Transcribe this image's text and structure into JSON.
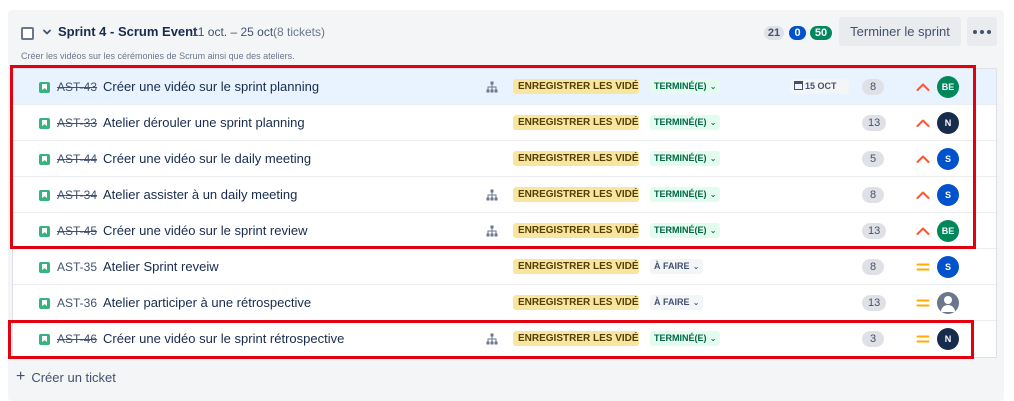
{
  "sprint": {
    "title": "Sprint 4 - Scrum Event",
    "dates": "11 oct. – 25 oct.",
    "ticket_count": "(8 tickets)",
    "goal": "Créer les vidéos sur les cérémonies de Scrum ainsi que des ateliers.",
    "counts": {
      "todo": "21",
      "in_progress": "0",
      "done": "50"
    },
    "end_button": "Terminer le sprint",
    "more_icon": "more-horizontal-icon"
  },
  "issues": [
    {
      "key": "AST-43",
      "summary": "Créer une vidéo sur le sprint planning",
      "epic": "ENREGISTRER LES VIDÉ...",
      "status": "TERMINÉ(E)",
      "status_type": "done",
      "due": "15 OCT",
      "points": "8",
      "priority": "high",
      "assignee": "BE",
      "has_child": true,
      "selected": true
    },
    {
      "key": "AST-33",
      "summary": "Atelier dérouler une sprint planning",
      "epic": "ENREGISTRER LES VIDÉ...",
      "status": "TERMINÉ(E)",
      "status_type": "done",
      "due": "",
      "points": "13",
      "priority": "high",
      "assignee": "N",
      "has_child": false,
      "selected": false
    },
    {
      "key": "AST-44",
      "summary": "Créer une vidéo sur le daily meeting",
      "epic": "ENREGISTRER LES VIDÉ...",
      "status": "TERMINÉ(E)",
      "status_type": "done",
      "due": "",
      "points": "5",
      "priority": "high",
      "assignee": "S",
      "has_child": false,
      "selected": false
    },
    {
      "key": "AST-34",
      "summary": "Atelier assister à un daily meeting",
      "epic": "ENREGISTRER LES VIDÉ...",
      "status": "TERMINÉ(E)",
      "status_type": "done",
      "due": "",
      "points": "8",
      "priority": "high",
      "assignee": "S",
      "has_child": true,
      "selected": false
    },
    {
      "key": "AST-45",
      "summary": "Créer une vidéo sur le sprint review",
      "epic": "ENREGISTRER LES VIDÉ...",
      "status": "TERMINÉ(E)",
      "status_type": "done",
      "due": "",
      "points": "13",
      "priority": "high",
      "assignee": "BE",
      "has_child": true,
      "selected": false
    },
    {
      "key": "AST-35",
      "summary": "Atelier Sprint reveiw",
      "epic": "ENREGISTRER LES VIDÉ...",
      "status": "À FAIRE",
      "status_type": "todo",
      "due": "",
      "points": "8",
      "priority": "medium",
      "assignee": "S",
      "has_child": false,
      "selected": false
    },
    {
      "key": "AST-36",
      "summary": "Atelier participer à une rétrospective",
      "epic": "ENREGISTRER LES VIDÉ...",
      "status": "À FAIRE",
      "status_type": "todo",
      "due": "",
      "points": "13",
      "priority": "medium",
      "assignee": "",
      "has_child": false,
      "selected": false
    },
    {
      "key": "AST-46",
      "summary": "Créer une vidéo sur le sprint rétrospective",
      "epic": "ENREGISTRER LES VIDÉ...",
      "status": "TERMINÉ(E)",
      "status_type": "done",
      "due": "",
      "points": "3",
      "priority": "medium",
      "assignee": "N",
      "has_child": true,
      "selected": false
    }
  ],
  "create_ticket": "Créer un ticket",
  "colors": {
    "highlight": "#e3000f",
    "priority_high": "#ff5630",
    "priority_medium": "#ffab00",
    "epic_bg": "#f8e6a0",
    "done_bg": "#e3fcef"
  }
}
